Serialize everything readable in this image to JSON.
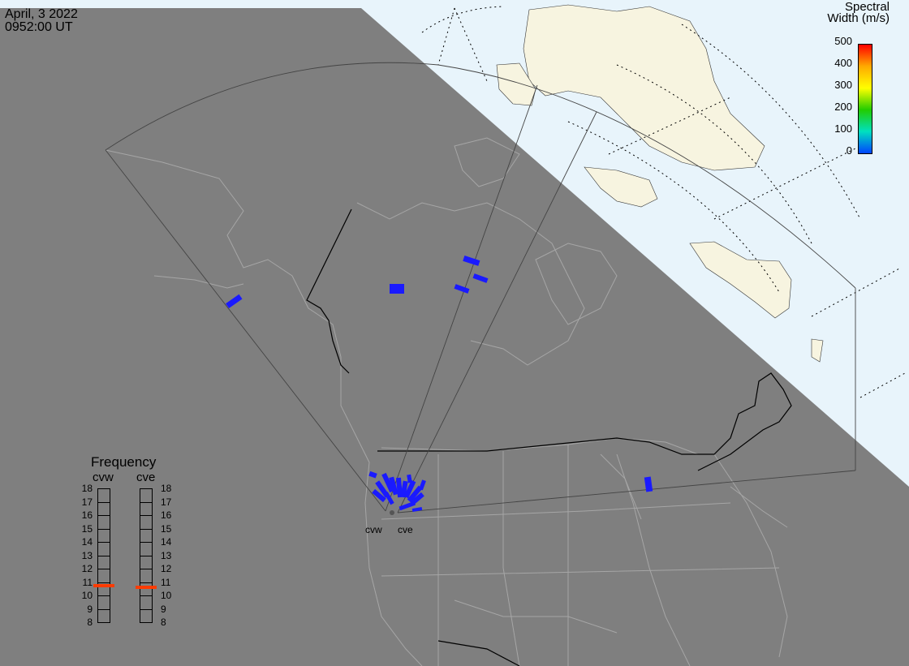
{
  "header": {
    "date": "April, 3 2022",
    "time": "0952:00 UT"
  },
  "legend": {
    "title_line1": "Spectral",
    "title_line2": "Width (m/s)",
    "ticks": [
      "500",
      "400",
      "300",
      "200",
      "100",
      "0"
    ],
    "colors": [
      "#ff0000",
      "#ffaa00",
      "#ffff00",
      "#22cc00",
      "#00e0c0",
      "#0044ff"
    ]
  },
  "frequency": {
    "title": "Frequency",
    "radar_west": "cvw",
    "radar_east": "cve",
    "levels": [
      "18",
      "17",
      "16",
      "15",
      "14",
      "13",
      "12",
      "11",
      "10",
      "9",
      "8"
    ],
    "cvw_value_mhz": 10.7,
    "cve_value_mhz": 10.6,
    "marker_color": "#ff3b00"
  },
  "sites": {
    "west_label": "cvw",
    "east_label": "cve"
  },
  "map_colors": {
    "night": "#7f7f7f",
    "day_ocean": "#e8f4fb",
    "day_land": "#f7f4e0",
    "echo": "#1a1aff"
  }
}
